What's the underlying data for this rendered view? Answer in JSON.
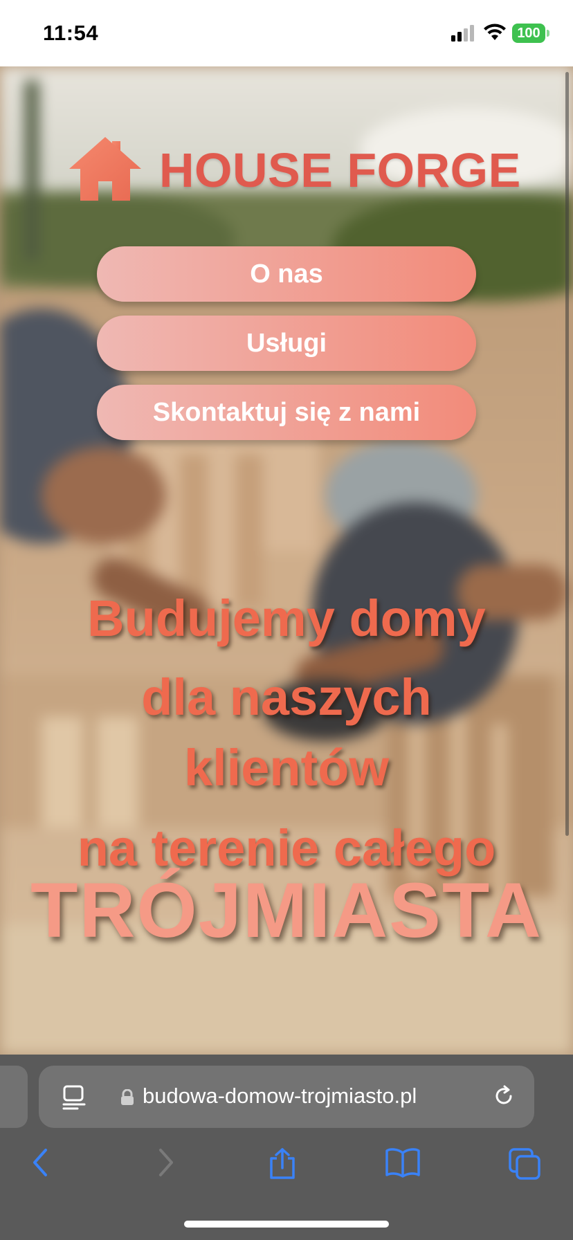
{
  "status_bar": {
    "time": "11:54",
    "battery": "100",
    "icons": [
      "signal-icon",
      "wifi-icon",
      "battery-icon"
    ],
    "battery_color": "#3ec14f"
  },
  "page": {
    "brand": {
      "name": "HOUSE FORGE",
      "icon": "house-icon",
      "color": "#e05a4e"
    },
    "nav": {
      "items": [
        {
          "label": "O nas"
        },
        {
          "label": "Usługi"
        },
        {
          "label": "Skontaktuj się z nami"
        }
      ],
      "gradient_start": "#efb8b3",
      "gradient_end": "#f28b7a"
    },
    "hero": {
      "lines": [
        "Budujemy domy",
        "dla naszych",
        "klientów",
        "na terenie całego",
        "TRÓJMIASTA"
      ],
      "text_color": "#ef6a4e",
      "accent_color": "#f59a86"
    }
  },
  "browser": {
    "url": "budowa-domow-trojmiasto.pl",
    "icons": {
      "reader": "reader-mode-icon",
      "lock": "lock-icon",
      "reload": "reload-icon",
      "back": "back-chevron-icon",
      "forward": "forward-chevron-icon",
      "share": "share-icon",
      "bookmarks": "bookmarks-icon",
      "tabs": "tabs-icon"
    },
    "accent": "#3a82f7"
  }
}
